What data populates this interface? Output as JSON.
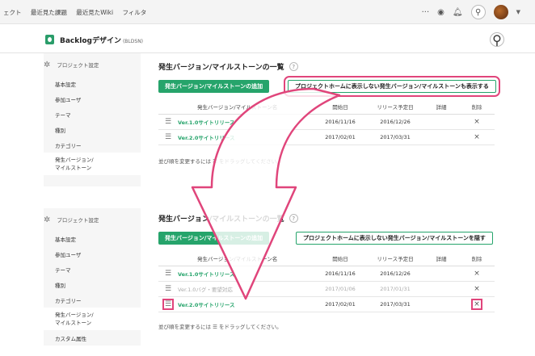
{
  "topbar": {
    "nav": [
      "ェクト",
      "最近見た課題",
      "最近見たWiki",
      "フィルタ"
    ],
    "icons": [
      "more-icon",
      "eye-icon",
      "bell-icon",
      "search-icon",
      "avatar"
    ]
  },
  "project": {
    "name": "Backlogデザイン",
    "key": "(BLDSN)"
  },
  "colors": {
    "accent": "#26a46b",
    "highlight": "#e0457b"
  },
  "top_panel": {
    "sidebar": {
      "heading": "プロジェクト設定",
      "items": [
        "基本設定",
        "参加ユーザ",
        "テーマ",
        "種別",
        "カテゴリー",
        "発生バージョン/\nマイルストーン"
      ]
    },
    "title": "発生バージョン/マイルストーンの一覧",
    "help": "?",
    "add_button": "発生バージョン/マイルストーンの追加",
    "toggle_button": "プロジェクトホームに表示しない発生バージョン/マイルストーンも表示する",
    "columns": [
      "発生バージョン/マイルストーン名",
      "開始日",
      "リリース予定日",
      "詳細",
      "削除"
    ],
    "rows": [
      {
        "name": "Ver.1.0サイトリリース",
        "start": "2016/11/16",
        "release": "2016/12/26",
        "del": "×"
      },
      {
        "name": "Ver.2.0サイトリリース",
        "start": "2017/02/01",
        "release": "2017/03/31",
        "del": "×"
      }
    ],
    "note": "並び順を変更するには ☰ をドラッグしてください。"
  },
  "bottom_panel": {
    "sidebar": {
      "heading": "プロジェクト設定",
      "items": [
        "基本設定",
        "参加ユーザ",
        "テーマ",
        "種別",
        "カテゴリー",
        "発生バージョン/\nマイルストーン",
        "カスタム属性"
      ]
    },
    "title": "発生バージョン/マイルストーンの一覧",
    "help": "?",
    "add_button": "発生バージョン/マイルストーンの追加",
    "toggle_button": "プロジェクトホームに表示しない発生バージョン/マイルストーンを隠す",
    "columns": [
      "発生バージョン/マイルストーン名",
      "開始日",
      "リリース予定日",
      "詳細",
      "削除"
    ],
    "rows": [
      {
        "name": "Ver.1.0サイトリリース",
        "start": "2016/11/16",
        "release": "2016/12/26",
        "del": "×"
      },
      {
        "name": "Ver.1.0バグ・要望対応",
        "start": "2017/01/06",
        "release": "2017/01/31",
        "del": "×"
      },
      {
        "name": "Ver.2.0サイトリリース",
        "start": "2017/02/01",
        "release": "2017/03/31",
        "del": "×"
      }
    ],
    "note_pre": "並び順を変更するには",
    "note_icon": "☰",
    "note_post": "をドラッグしてください。"
  }
}
